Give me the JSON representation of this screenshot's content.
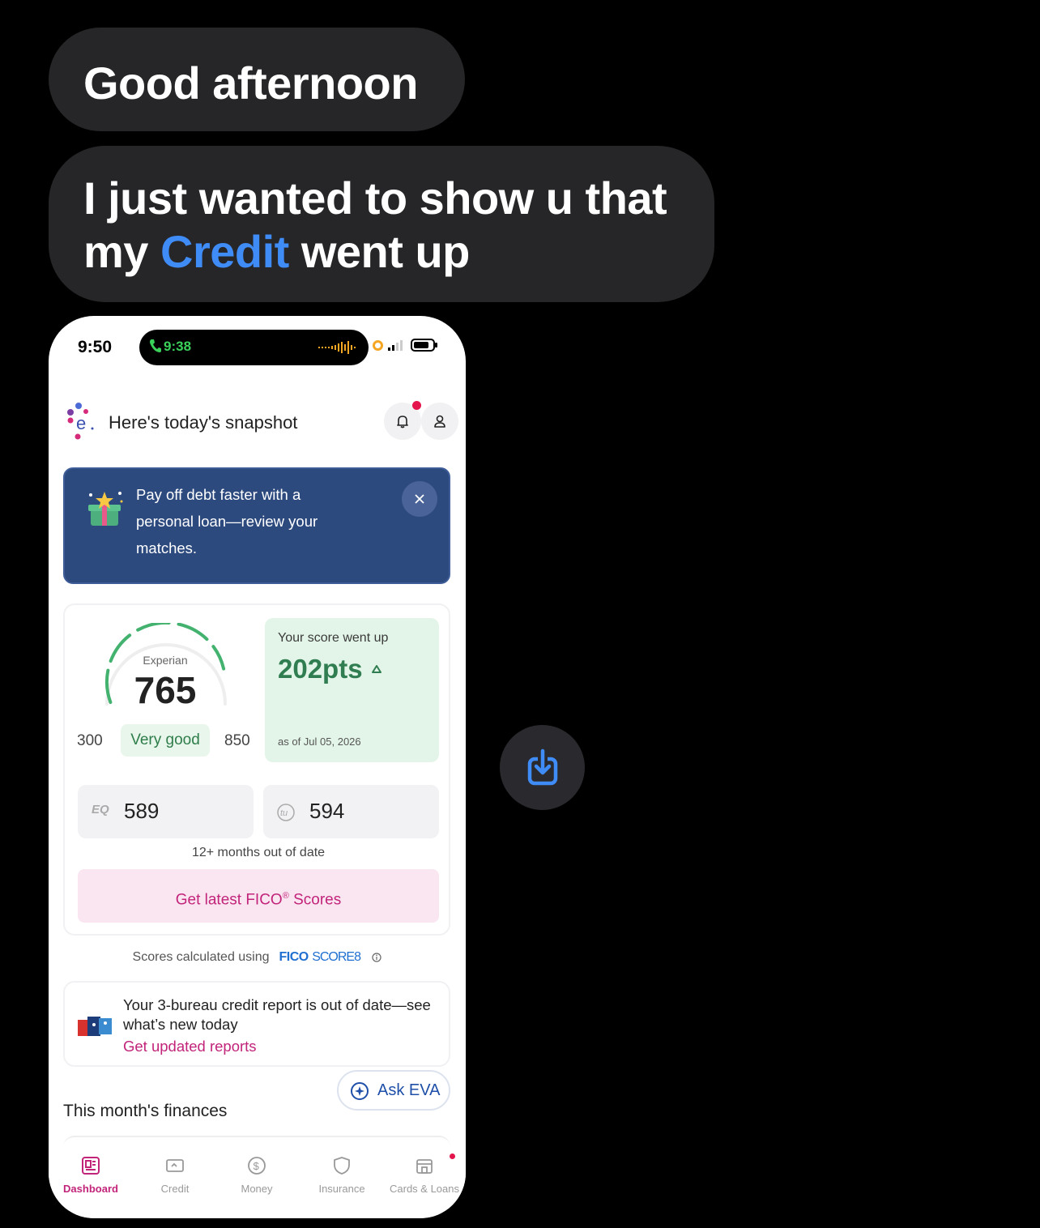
{
  "messages": [
    {
      "text": "Good afternoon"
    },
    {
      "text_before": "I just wanted to show u that my ",
      "link": "Credit",
      "text_after": " went up"
    }
  ],
  "screenshot": {
    "status_time": "9:50",
    "call_time": "9:38",
    "header_title": "Here's today's snapshot",
    "promo_text": "Pay off debt faster with a personal loan—review your matches.",
    "score": {
      "bureau": "Experian",
      "value": "765",
      "min": "300",
      "max": "850",
      "rating": "Very good",
      "gauge_fraction": 0.85
    },
    "went_up": {
      "label": "Your score went up",
      "value": "202pts",
      "date": "as of Jul 05, 2026"
    },
    "bureaus": [
      {
        "logo": "EQ",
        "value": "589"
      },
      {
        "logo": "tu",
        "value": "594"
      }
    ],
    "outdated_text": "12+ months out of date",
    "fico_button": "Get latest FICO",
    "fico_button_suffix": " Scores",
    "fico_sup": "®",
    "calc_text": "Scores calculated using",
    "fico_brand": "FICO",
    "fico_score_label": "SCORE8",
    "report": {
      "text": "Your 3-bureau credit report is out of date—see what’s new today",
      "link": "Get updated reports"
    },
    "ask_eva": "Ask EVA",
    "section_title": "This month's finances",
    "tabs": [
      {
        "label": "Dashboard",
        "icon": "dashboard-icon",
        "active": true
      },
      {
        "label": "Credit",
        "icon": "credit-card-icon",
        "active": false
      },
      {
        "label": "Money",
        "icon": "dollar-icon",
        "active": false
      },
      {
        "label": "Insurance",
        "icon": "shield-icon",
        "active": false
      },
      {
        "label": "Cards & Loans",
        "icon": "store-icon",
        "active": false
      }
    ]
  },
  "colors": {
    "background": "#000000",
    "bubble": "#262628",
    "link": "#3f8cf7",
    "promo": "#2d4a7f",
    "accent_pink": "#c2247a",
    "green": "#2f7d50"
  }
}
